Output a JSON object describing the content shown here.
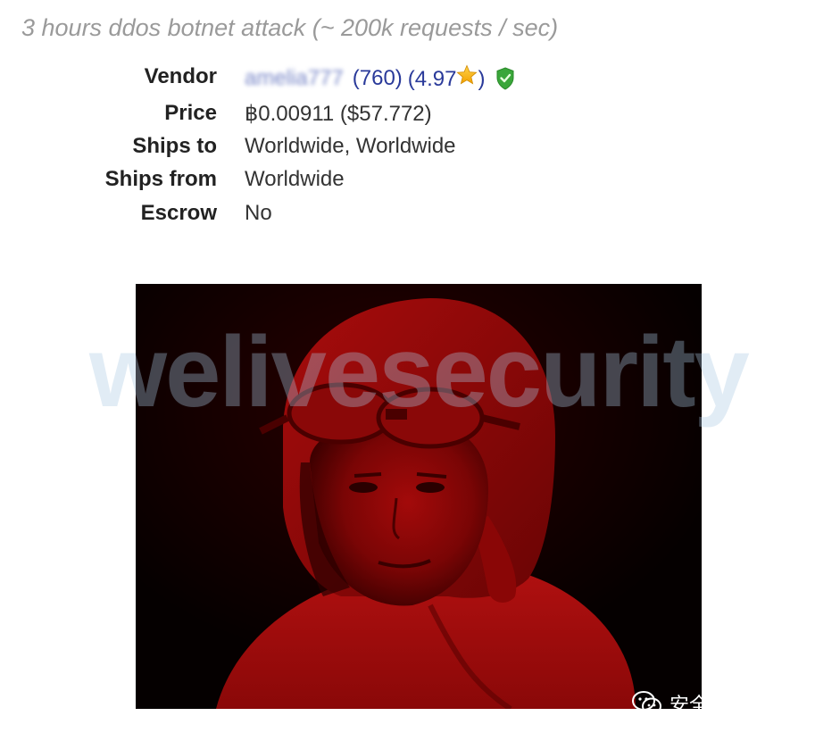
{
  "listing": {
    "title": "3 hours ddos botnet attack (~ 200k requests / sec)"
  },
  "details": {
    "vendor": {
      "label": "Vendor",
      "name": "amelia777",
      "feedback_count": "(760)",
      "rating_open": "(4.97",
      "rating_close": ")",
      "icons": [
        "star-icon",
        "verified-shield-icon"
      ]
    },
    "price": {
      "label": "Price",
      "value": "฿0.00911 ($57.772)"
    },
    "ships_to": {
      "label": "Ships to",
      "value": "Worldwide, Worldwide"
    },
    "ships_from": {
      "label": "Ships from",
      "value": "Worldwide"
    },
    "escrow": {
      "label": "Escrow",
      "value": "No"
    }
  },
  "watermark": {
    "text": "welivesecurity"
  },
  "wechat_badge": {
    "text": "安全分析与研究",
    "icon": "wechat-icon"
  },
  "colors": {
    "title": "#9a9a9a",
    "link": "#2a3a9a",
    "photo_tint": "#9e0606",
    "watermark": "#aac8e1"
  }
}
